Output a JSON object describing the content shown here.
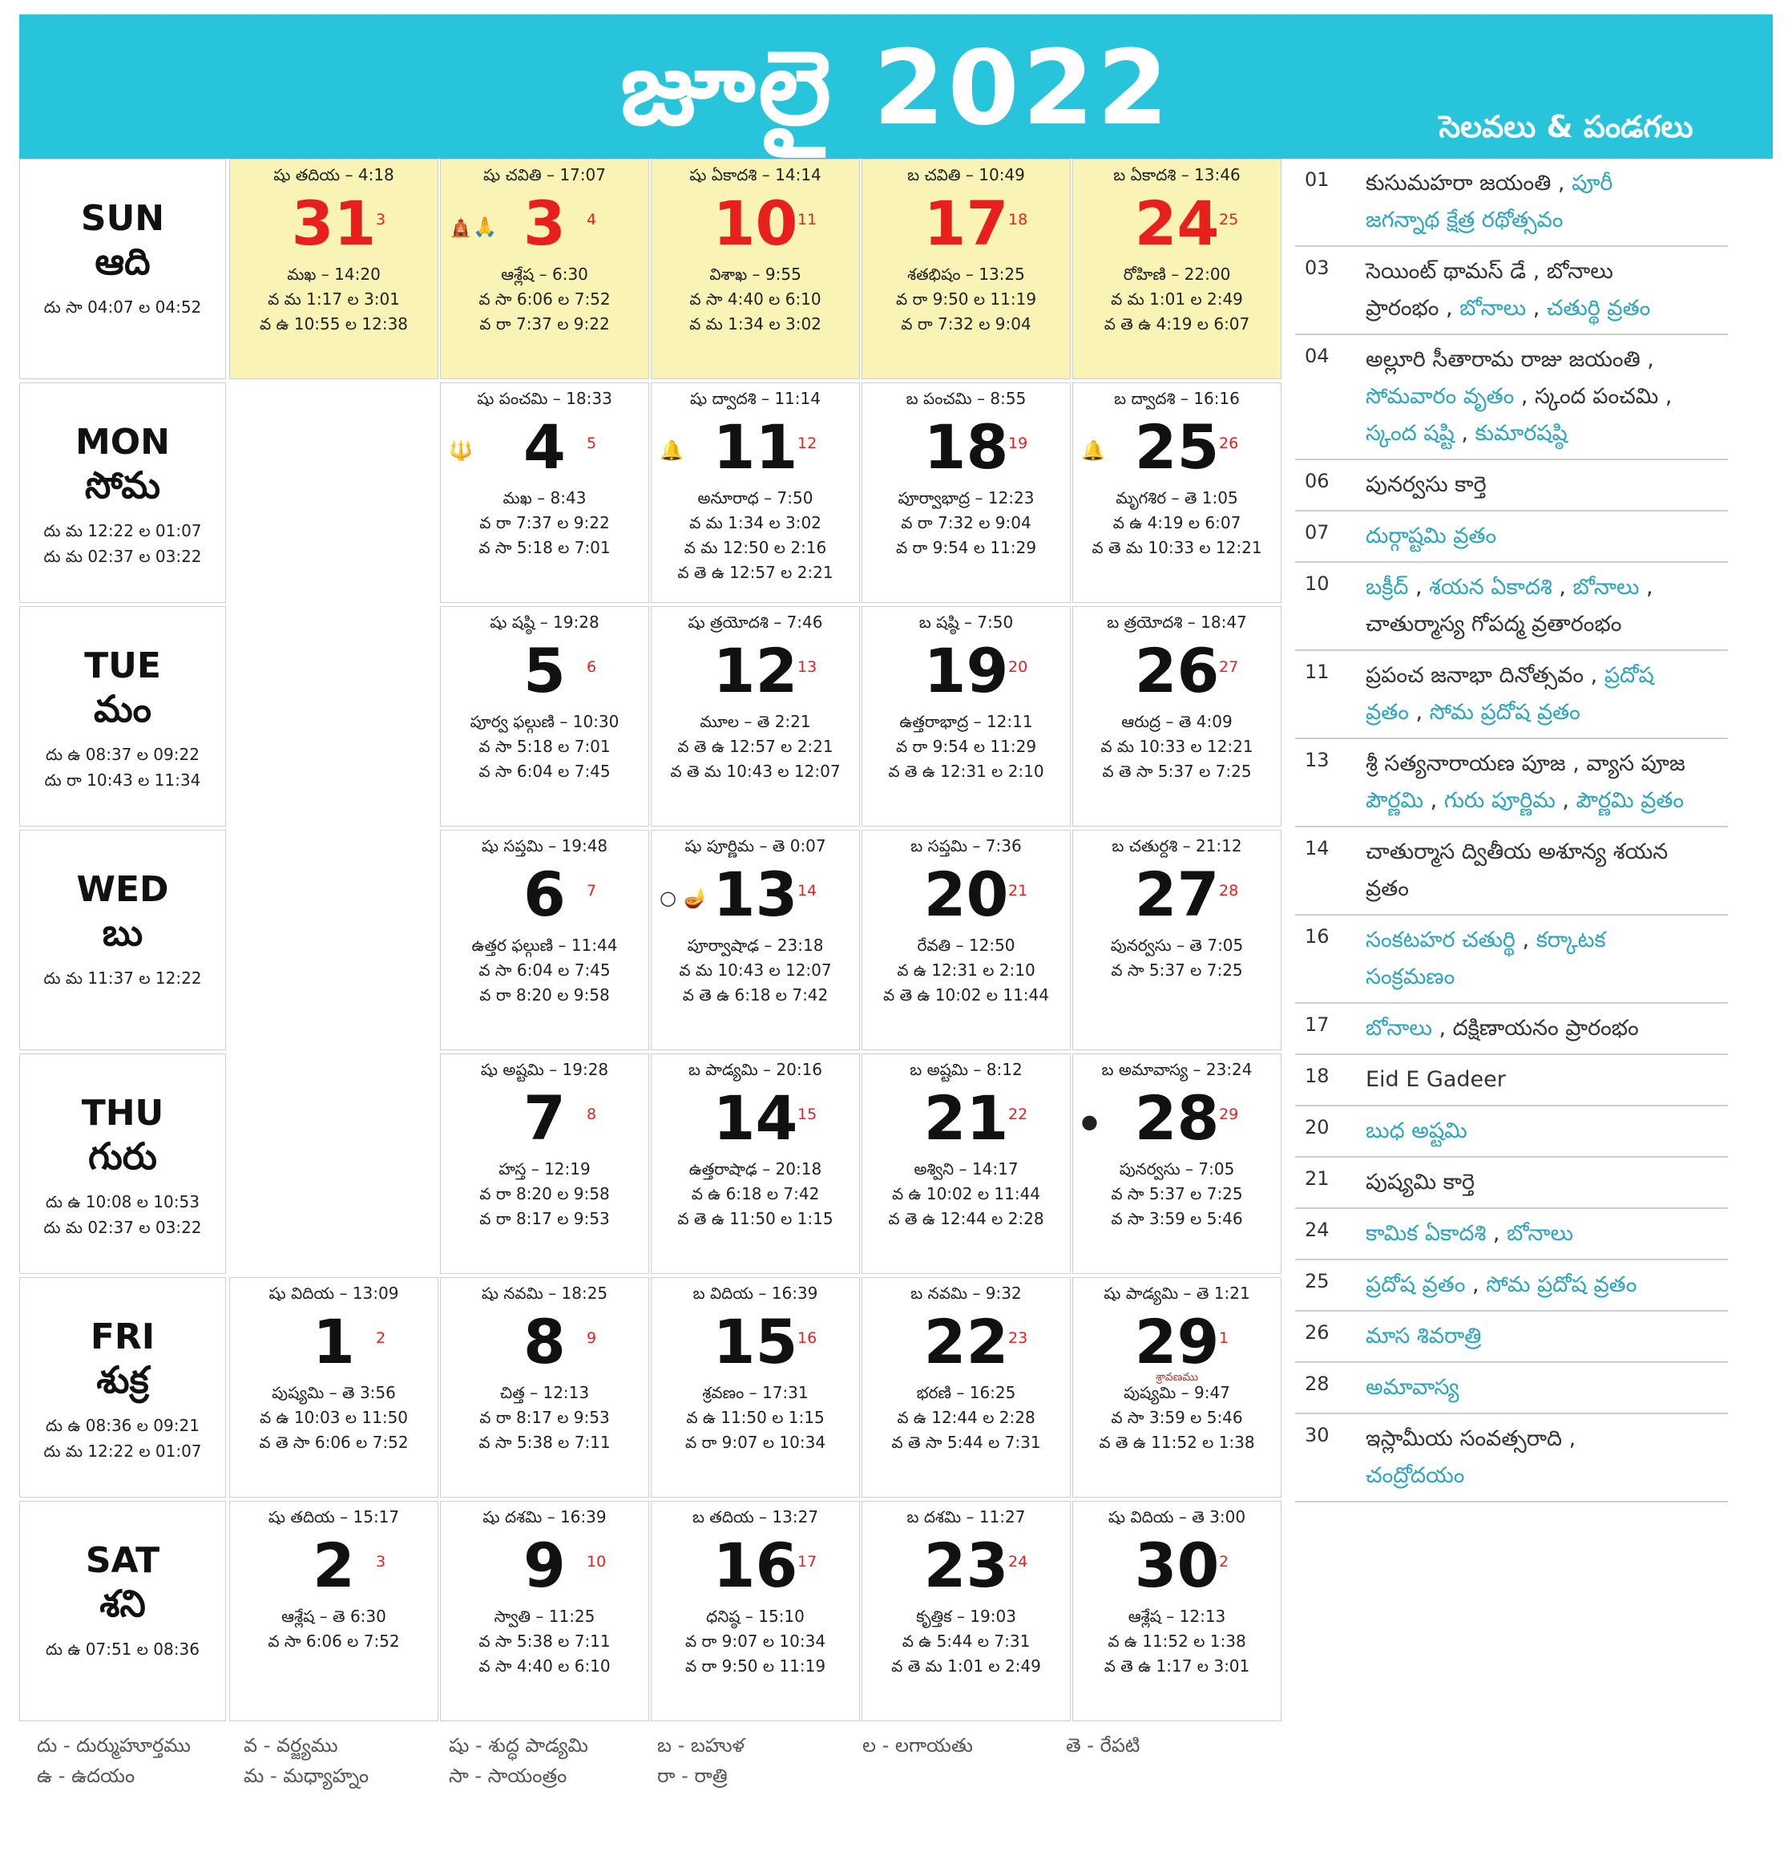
{
  "header": {
    "title": "జూలై 2022",
    "subtitle": "సెలవలు & పండగలు"
  },
  "days": [
    {
      "en": "SUN",
      "te": "ఆది",
      "times": [
        "దు సా 04:07 ల 04:52"
      ]
    },
    {
      "en": "MON",
      "te": "సోమ",
      "times": [
        "దు మ 12:22 ల 01:07",
        "దు మ 02:37 ల 03:22"
      ]
    },
    {
      "en": "TUE",
      "te": "మం",
      "times": [
        "దు ఉ 08:37 ల 09:22",
        "దు రా 10:43 ల 11:34"
      ]
    },
    {
      "en": "WED",
      "te": "బు",
      "times": [
        "దు మ 11:37 ల 12:22"
      ]
    },
    {
      "en": "THU",
      "te": "గురు",
      "times": [
        "దు ఉ 10:08 ల 10:53",
        "దు మ 02:37 ల 03:22"
      ]
    },
    {
      "en": "FRI",
      "te": "శుక్ర",
      "times": [
        "దు ఉ 08:36 ల 09:21",
        "దు మ 12:22 ల 01:07"
      ]
    },
    {
      "en": "SAT",
      "te": "శని",
      "times": [
        "దు ఉ 07:51 ల 08:36"
      ]
    }
  ],
  "weeks": [
    [
      {
        "tithi": "షు తదియ – 4:18",
        "date": "31",
        "lunar": "3",
        "lines": [
          "మఖ – 14:20",
          "వ మ 1:17 ల 3:01",
          "వ ఉ 10:55 ల 12:38"
        ]
      },
      {
        "tithi": "షు చవితి – 17:07",
        "date": "3",
        "lunar": "4",
        "icons": [
          "🛕",
          "🙏"
        ],
        "lines": [
          "ఆశ్లేష – 6:30",
          "వ సా 6:06 ల 7:52",
          "వ రా 7:37 ల 9:22"
        ]
      },
      {
        "tithi": "షు ఏకాదశి – 14:14",
        "date": "10",
        "lunar": "11",
        "lines": [
          "విశాఖ – 9:55",
          "వ సా 4:40 ల 6:10",
          "వ మ 1:34 ల 3:02"
        ]
      },
      {
        "tithi": "బ చవితి – 10:49",
        "date": "17",
        "lunar": "18",
        "lines": [
          "శతభిషం – 13:25",
          "వ రా 9:50 ల 11:19",
          "వ రా 7:32 ల 9:04"
        ]
      },
      {
        "tithi": "బ ఏకాదశి – 13:46",
        "date": "24",
        "lunar": "25",
        "lines": [
          "రోహిణి – 22:00",
          "వ మ 1:01 ల 2:49",
          "వ తె ఉ 4:19 ల 6:07"
        ]
      }
    ],
    [
      null,
      {
        "tithi": "షు పంచమి – 18:33",
        "date": "4",
        "lunar": "5",
        "icons": [
          "🔱"
        ],
        "lines": [
          "మఖ – 8:43",
          "వ రా 7:37 ల 9:22",
          "వ సా 5:18 ల 7:01"
        ]
      },
      {
        "tithi": "షు ద్వాదశి – 11:14",
        "date": "11",
        "lunar": "12",
        "icons": [
          "🔔"
        ],
        "lines": [
          "అనూరాధ – 7:50",
          "వ మ 1:34 ల 3:02",
          "వ మ 12:50 ల 2:16",
          "వ తె ఉ 12:57 ల 2:21"
        ]
      },
      {
        "tithi": "బ పంచమి – 8:55",
        "date": "18",
        "lunar": "19",
        "lines": [
          "పూర్వాభాద్ర – 12:23",
          "వ రా 7:32 ల 9:04",
          "వ రా 9:54 ల 11:29"
        ]
      },
      {
        "tithi": "బ ద్వాదశి – 16:16",
        "date": "25",
        "lunar": "26",
        "icons": [
          "🔔"
        ],
        "lines": [
          "మృగశిర – తె 1:05",
          "వ ఉ 4:19 ల 6:07",
          "వ తె మ 10:33 ల 12:21"
        ]
      }
    ],
    [
      null,
      {
        "tithi": "షు షష్ఠి – 19:28",
        "date": "5",
        "lunar": "6",
        "lines": [
          "పూర్వ ఫల్గుణి – 10:30",
          "వ సా 5:18 ల 7:01",
          "వ సా 6:04 ల 7:45"
        ]
      },
      {
        "tithi": "షు త్రయోదశి – 7:46",
        "date": "12",
        "lunar": "13",
        "lines": [
          "మూల – తె 2:21",
          "వ తె ఉ 12:57 ల 2:21",
          "వ తె మ 10:43 ల 12:07"
        ]
      },
      {
        "tithi": "బ షష్ఠి – 7:50",
        "date": "19",
        "lunar": "20",
        "lines": [
          "ఉత్తరాభాద్ర – 12:11",
          "వ రా 9:54 ల 11:29",
          "వ తె ఉ 12:31 ల 2:10"
        ]
      },
      {
        "tithi": "బ త్రయోదశి – 18:47",
        "date": "26",
        "lunar": "27",
        "lines": [
          "ఆరుద్ర – తె 4:09",
          "వ మ 10:33 ల 12:21",
          "వ తె సా 5:37 ల 7:25"
        ]
      }
    ],
    [
      null,
      {
        "tithi": "షు సప్తమి – 19:48",
        "date": "6",
        "lunar": "7",
        "lines": [
          "ఉత్తర ఫల్గుణి – 11:44",
          "వ సా 6:04 ల 7:45",
          "వ రా 8:20 ల 9:58"
        ]
      },
      {
        "tithi": "షు పూర్ణిమ – తె 0:07",
        "date": "13",
        "lunar": "14",
        "icons": [
          "○",
          "🪔"
        ],
        "lines": [
          "పూర్వాషాఢ – 23:18",
          "వ మ 10:43 ల 12:07",
          "వ తె ఉ 6:18 ల 7:42"
        ]
      },
      {
        "tithi": "బ సప్తమి – 7:36",
        "date": "20",
        "lunar": "21",
        "lines": [
          "రేవతి – 12:50",
          "వ ఉ 12:31 ల 2:10",
          "వ తె ఉ 10:02 ల 11:44"
        ]
      },
      {
        "tithi": "బ చతుర్దశి – 21:12",
        "date": "27",
        "lunar": "28",
        "lines": [
          "పునర్వసు – తె 7:05",
          "వ సా 5:37 ల 7:25"
        ]
      }
    ],
    [
      null,
      {
        "tithi": "షు అష్టమి – 19:28",
        "date": "7",
        "lunar": "8",
        "lines": [
          "హస్త – 12:19",
          "వ రా 8:20 ల 9:58",
          "వ రా 8:17 ల 9:53"
        ]
      },
      {
        "tithi": "బ పాడ్యమి – 20:16",
        "date": "14",
        "lunar": "15",
        "lines": [
          "ఉత్తరాషాఢ – 20:18",
          "వ ఉ 6:18 ల 7:42",
          "వ తె ఉ 11:50 ల 1:15"
        ]
      },
      {
        "tithi": "బ అష్టమి – 8:12",
        "date": "21",
        "lunar": "22",
        "lines": [
          "అశ్విని – 14:17",
          "వ ఉ 10:02 ల 11:44",
          "వ తె ఉ 12:44 ల 2:28"
        ]
      },
      {
        "tithi": "బ అమావాస్య – 23:24",
        "date": "28",
        "lunar": "29",
        "icons": [
          "●"
        ],
        "lines": [
          "పునర్వసు – 7:05",
          "వ సా 5:37 ల 7:25",
          "వ సా 3:59 ల 5:46"
        ]
      }
    ],
    [
      {
        "tithi": "షు విదియ – 13:09",
        "date": "1",
        "lunar": "2",
        "lines": [
          "పుష్యమి – తె 3:56",
          "వ ఉ 10:03 ల 11:50",
          "వ తె సా 6:06 ల 7:52"
        ]
      },
      {
        "tithi": "షు నవమి – 18:25",
        "date": "8",
        "lunar": "9",
        "lines": [
          "చిత్త – 12:13",
          "వ రా 8:17 ల 9:53",
          "వ సా 5:38 ల 7:11"
        ]
      },
      {
        "tithi": "బ విదియ – 16:39",
        "date": "15",
        "lunar": "16",
        "lines": [
          "శ్రవణం – 17:31",
          "వ ఉ 11:50 ల 1:15",
          "వ రా 9:07 ల 10:34"
        ]
      },
      {
        "tithi": "బ నవమి – 9:32",
        "date": "22",
        "lunar": "23",
        "lines": [
          "భరణి – 16:25",
          "వ ఉ 12:44 ల 2:28",
          "వ తె సా 5:44 ల 7:31"
        ]
      },
      {
        "tithi": "షు పాడ్యమి – తె 1:21",
        "date": "29",
        "lunar": "1",
        "note": "శ్రావణము",
        "lines": [
          "పుష్యమి – 9:47",
          "వ సా 3:59 ల 5:46",
          "వ తె ఉ 11:52 ల 1:38"
        ]
      }
    ],
    [
      {
        "tithi": "షు తదియ – 15:17",
        "date": "2",
        "lunar": "3",
        "lines": [
          "ఆశ్లేష – తె 6:30",
          "వ సా 6:06 ల 7:52"
        ]
      },
      {
        "tithi": "షు దశమి – 16:39",
        "date": "9",
        "lunar": "10",
        "lines": [
          "స్వాతి – 11:25",
          "వ సా 5:38 ల 7:11",
          "వ సా 4:40 ల 6:10"
        ]
      },
      {
        "tithi": "బ తదియ – 13:27",
        "date": "16",
        "lunar": "17",
        "lines": [
          "ధనిష్ఠ – 15:10",
          "వ రా 9:07 ల 10:34",
          "వ రా 9:50 ల 11:19"
        ]
      },
      {
        "tithi": "బ దశమి – 11:27",
        "date": "23",
        "lunar": "24",
        "lines": [
          "కృత్తిక – 19:03",
          "వ ఉ 5:44 ల 7:31",
          "వ తె మ 1:01 ల 2:49"
        ]
      },
      {
        "tithi": "షు విదియ – తె 3:00",
        "date": "30",
        "lunar": "2",
        "lines": [
          "ఆశ్లేష – 12:13",
          "వ ఉ 11:52 ల 1:38",
          "వ తె ఉ 1:17 ల 3:01"
        ]
      }
    ]
  ],
  "legend": [
    [
      "దు - దుర్ముహూర్తము",
      "ఉ - ఉదయం"
    ],
    [
      "వ - వర్జ్యము",
      "మ - మధ్యాహ్నం"
    ],
    [
      "షు - శుద్ధ పాడ్యమి",
      "సా - సాయంత్రం"
    ],
    [
      "బ - బహుళ",
      "రా - రాత్రి"
    ],
    [
      "ల - లగాయతు"
    ],
    [
      "తె - రేపటి"
    ]
  ],
  "festivals": [
    {
      "day": "01",
      "lines": [
        [
          [
            "కుసుమహరా జయంతి , ",
            false
          ],
          [
            "పూరీ",
            true
          ]
        ],
        [
          [
            "జగన్నాథ క్షేత్ర రథోత్సవం",
            true
          ]
        ]
      ]
    },
    {
      "day": "03",
      "lines": [
        [
          [
            "సెయింట్ థామస్ డే , బోనాలు",
            false
          ]
        ],
        [
          [
            "ప్రారంభం , ",
            false
          ],
          [
            "బోనాలు",
            true
          ],
          [
            " , ",
            false
          ],
          [
            "చతుర్థి వ్రతం",
            true
          ]
        ]
      ]
    },
    {
      "day": "04",
      "lines": [
        [
          [
            "అల్లూరి సీతారామ రాజు జయంతి ,",
            false
          ]
        ],
        [
          [
            "సోమవారం వృతం",
            true
          ],
          [
            " , స్కంద పంచమి ,",
            false
          ]
        ],
        [
          [
            "స్కంద షష్టి",
            true
          ],
          [
            " , ",
            false
          ],
          [
            "కుమారషష్ఠి",
            true
          ]
        ]
      ]
    },
    {
      "day": "06",
      "lines": [
        [
          [
            "పునర్వసు కార్తె",
            false
          ]
        ]
      ]
    },
    {
      "day": "07",
      "lines": [
        [
          [
            "దుర్గాష్టమి వ్రతం",
            true
          ]
        ]
      ]
    },
    {
      "day": "10",
      "lines": [
        [
          [
            "బక్రీద్",
            true
          ],
          [
            " , ",
            false
          ],
          [
            "శయన ఏకాదశి",
            true
          ],
          [
            " , ",
            false
          ],
          [
            "బోనాలు",
            true
          ],
          [
            " ,",
            false
          ]
        ],
        [
          [
            "చాతుర్మాస్య గోపద్మ వ్రతారంభం",
            false
          ]
        ]
      ]
    },
    {
      "day": "11",
      "lines": [
        [
          [
            "ప్రపంచ జనాభా దినోత్సవం , ",
            false
          ],
          [
            "ప్రదోష",
            true
          ]
        ],
        [
          [
            "వ్రతం",
            true
          ],
          [
            " , ",
            false
          ],
          [
            "సోమ ప్రదోష వ్రతం",
            true
          ]
        ]
      ]
    },
    {
      "day": "13",
      "lines": [
        [
          [
            "శ్రీ సత్యనారాయణ పూజ , వ్యాస పూజ",
            false
          ]
        ],
        [
          [
            "పౌర్ణమి",
            true
          ],
          [
            " , ",
            false
          ],
          [
            "గురు పూర్ణిమ",
            true
          ],
          [
            " , ",
            false
          ],
          [
            "పౌర్ణమి వ్రతం",
            true
          ]
        ]
      ]
    },
    {
      "day": "14",
      "lines": [
        [
          [
            "చాతుర్మాస ద్వితీయ అశూన్య శయన",
            false
          ]
        ],
        [
          [
            "వ్రతం",
            false
          ]
        ]
      ]
    },
    {
      "day": "16",
      "lines": [
        [
          [
            "సంకటహర చతుర్థి",
            true
          ],
          [
            " , ",
            false
          ],
          [
            "కర్కాటక",
            true
          ]
        ],
        [
          [
            "సంక్రమణం",
            true
          ]
        ]
      ]
    },
    {
      "day": "17",
      "lines": [
        [
          [
            "బోనాలు",
            true
          ],
          [
            " , దక్షిణాయనం ప్రారంభం",
            false
          ]
        ]
      ]
    },
    {
      "day": "18",
      "lines": [
        [
          [
            "Eid E Gadeer",
            false
          ]
        ]
      ]
    },
    {
      "day": "20",
      "lines": [
        [
          [
            "బుధ అష్టమి",
            true
          ]
        ]
      ]
    },
    {
      "day": "21",
      "lines": [
        [
          [
            "పుష్యమి కార్తె",
            false
          ]
        ]
      ]
    },
    {
      "day": "24",
      "lines": [
        [
          [
            "కామిక ఏకాదశి",
            true
          ],
          [
            " , ",
            false
          ],
          [
            "బోనాలు",
            true
          ]
        ]
      ]
    },
    {
      "day": "25",
      "lines": [
        [
          [
            "ప్రదోష వ్రతం",
            true
          ],
          [
            " , ",
            false
          ],
          [
            "సోమ ప్రదోష వ్రతం",
            true
          ]
        ]
      ]
    },
    {
      "day": "26",
      "lines": [
        [
          [
            "మాస శివరాత్రి",
            true
          ]
        ]
      ]
    },
    {
      "day": "28",
      "lines": [
        [
          [
            "అమావాస్య",
            true
          ]
        ]
      ]
    },
    {
      "day": "30",
      "lines": [
        [
          [
            "ఇస్లామీయ సంవత్సరాది ,",
            false
          ]
        ],
        [
          [
            "చంద్రోదయం",
            true
          ]
        ]
      ]
    }
  ],
  "colors": {
    "banner": "#28c4dc",
    "sunday_bg": "#faf3b6",
    "red": "#e8201d",
    "link": "#2aa6bf"
  }
}
